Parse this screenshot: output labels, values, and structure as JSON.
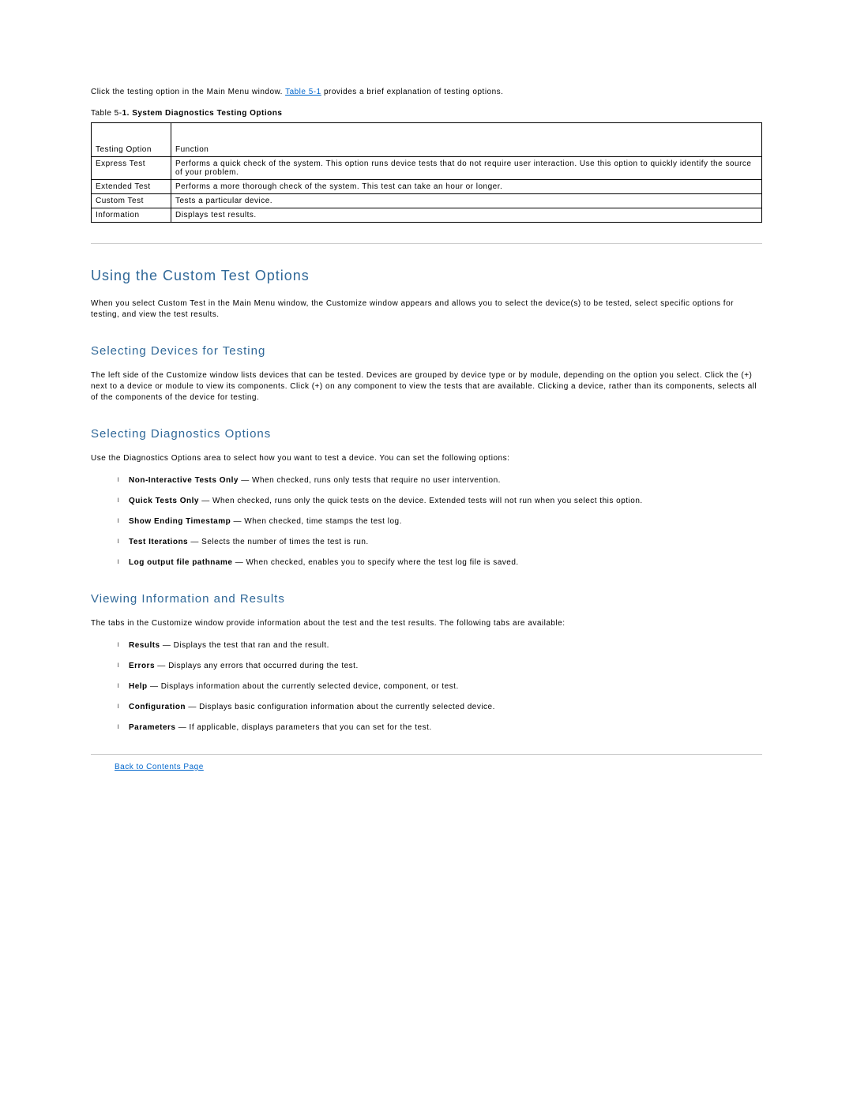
{
  "intro": {
    "prefix": "Click the testing option in the Main Menu window. ",
    "link": "Table 5-1",
    "suffix": " provides a brief explanation of testing options."
  },
  "table": {
    "caption_prefix": "Table 5-",
    "caption_bold": "1. System Diagnostics Testing Options",
    "headers": [
      "Testing Option",
      "Function"
    ],
    "rows": [
      [
        "Express Test",
        "Performs a quick check of the system. This option runs device tests that do not require user interaction. Use this option to quickly identify the source of your problem."
      ],
      [
        "Extended Test",
        "Performs a more thorough check of the system. This test can take an hour or longer."
      ],
      [
        "Custom Test",
        "Tests a particular device."
      ],
      [
        "Information",
        "Displays test results."
      ]
    ]
  },
  "sections": {
    "using_heading": "Using the Custom Test Options",
    "using_body": "When you select Custom Test in the Main Menu window, the Customize window appears and allows you to select the device(s) to be tested, select specific options for testing, and view the test results.",
    "sel_dev_heading": "Selecting Devices for Testing",
    "sel_dev_body": "The left side of the Customize window lists devices that can be tested. Devices are grouped by device type or by module, depending on the option you select. Click the (+) next to a device or module to view its components. Click (+) on any component to view the tests that are available. Clicking a device, rather than its components, selects all of the components of the device for testing.",
    "sel_diag_heading": "Selecting Diagnostics Options",
    "sel_diag_body": "Use the Diagnostics Options area to select how you want to test a device. You can set the following options:",
    "diag_items": [
      {
        "term": "Non-Interactive Tests Only",
        "desc": " — When checked, runs only tests that require no user intervention."
      },
      {
        "term": "Quick Tests Only",
        "desc": " — When checked, runs only the quick tests on the device. Extended tests will not run when you select this option."
      },
      {
        "term": "Show Ending Timestamp",
        "desc": " — When checked, time stamps the test log."
      },
      {
        "term": "Test Iterations",
        "desc": " — Selects the number of times the test is run."
      },
      {
        "term": "Log output file pathname",
        "desc": " — When checked, enables you to specify where the test log file is saved."
      }
    ],
    "view_heading": "Viewing Information and Results",
    "view_body": "The tabs in the Customize window provide information about the test and the test results. The following tabs are available:",
    "view_items": [
      {
        "term": "Results",
        "desc": " — Displays the test that ran and the result."
      },
      {
        "term": "Errors",
        "desc": " — Displays any errors that occurred during the test."
      },
      {
        "term": "Help",
        "desc": " — Displays information about the currently selected device, component, or test."
      },
      {
        "term": "Configuration",
        "desc": " — Displays basic configuration information about the currently selected device."
      },
      {
        "term": "Parameters",
        "desc": " — If applicable, displays parameters that you can set for the test."
      }
    ]
  },
  "back_link": "Back to Contents Page"
}
